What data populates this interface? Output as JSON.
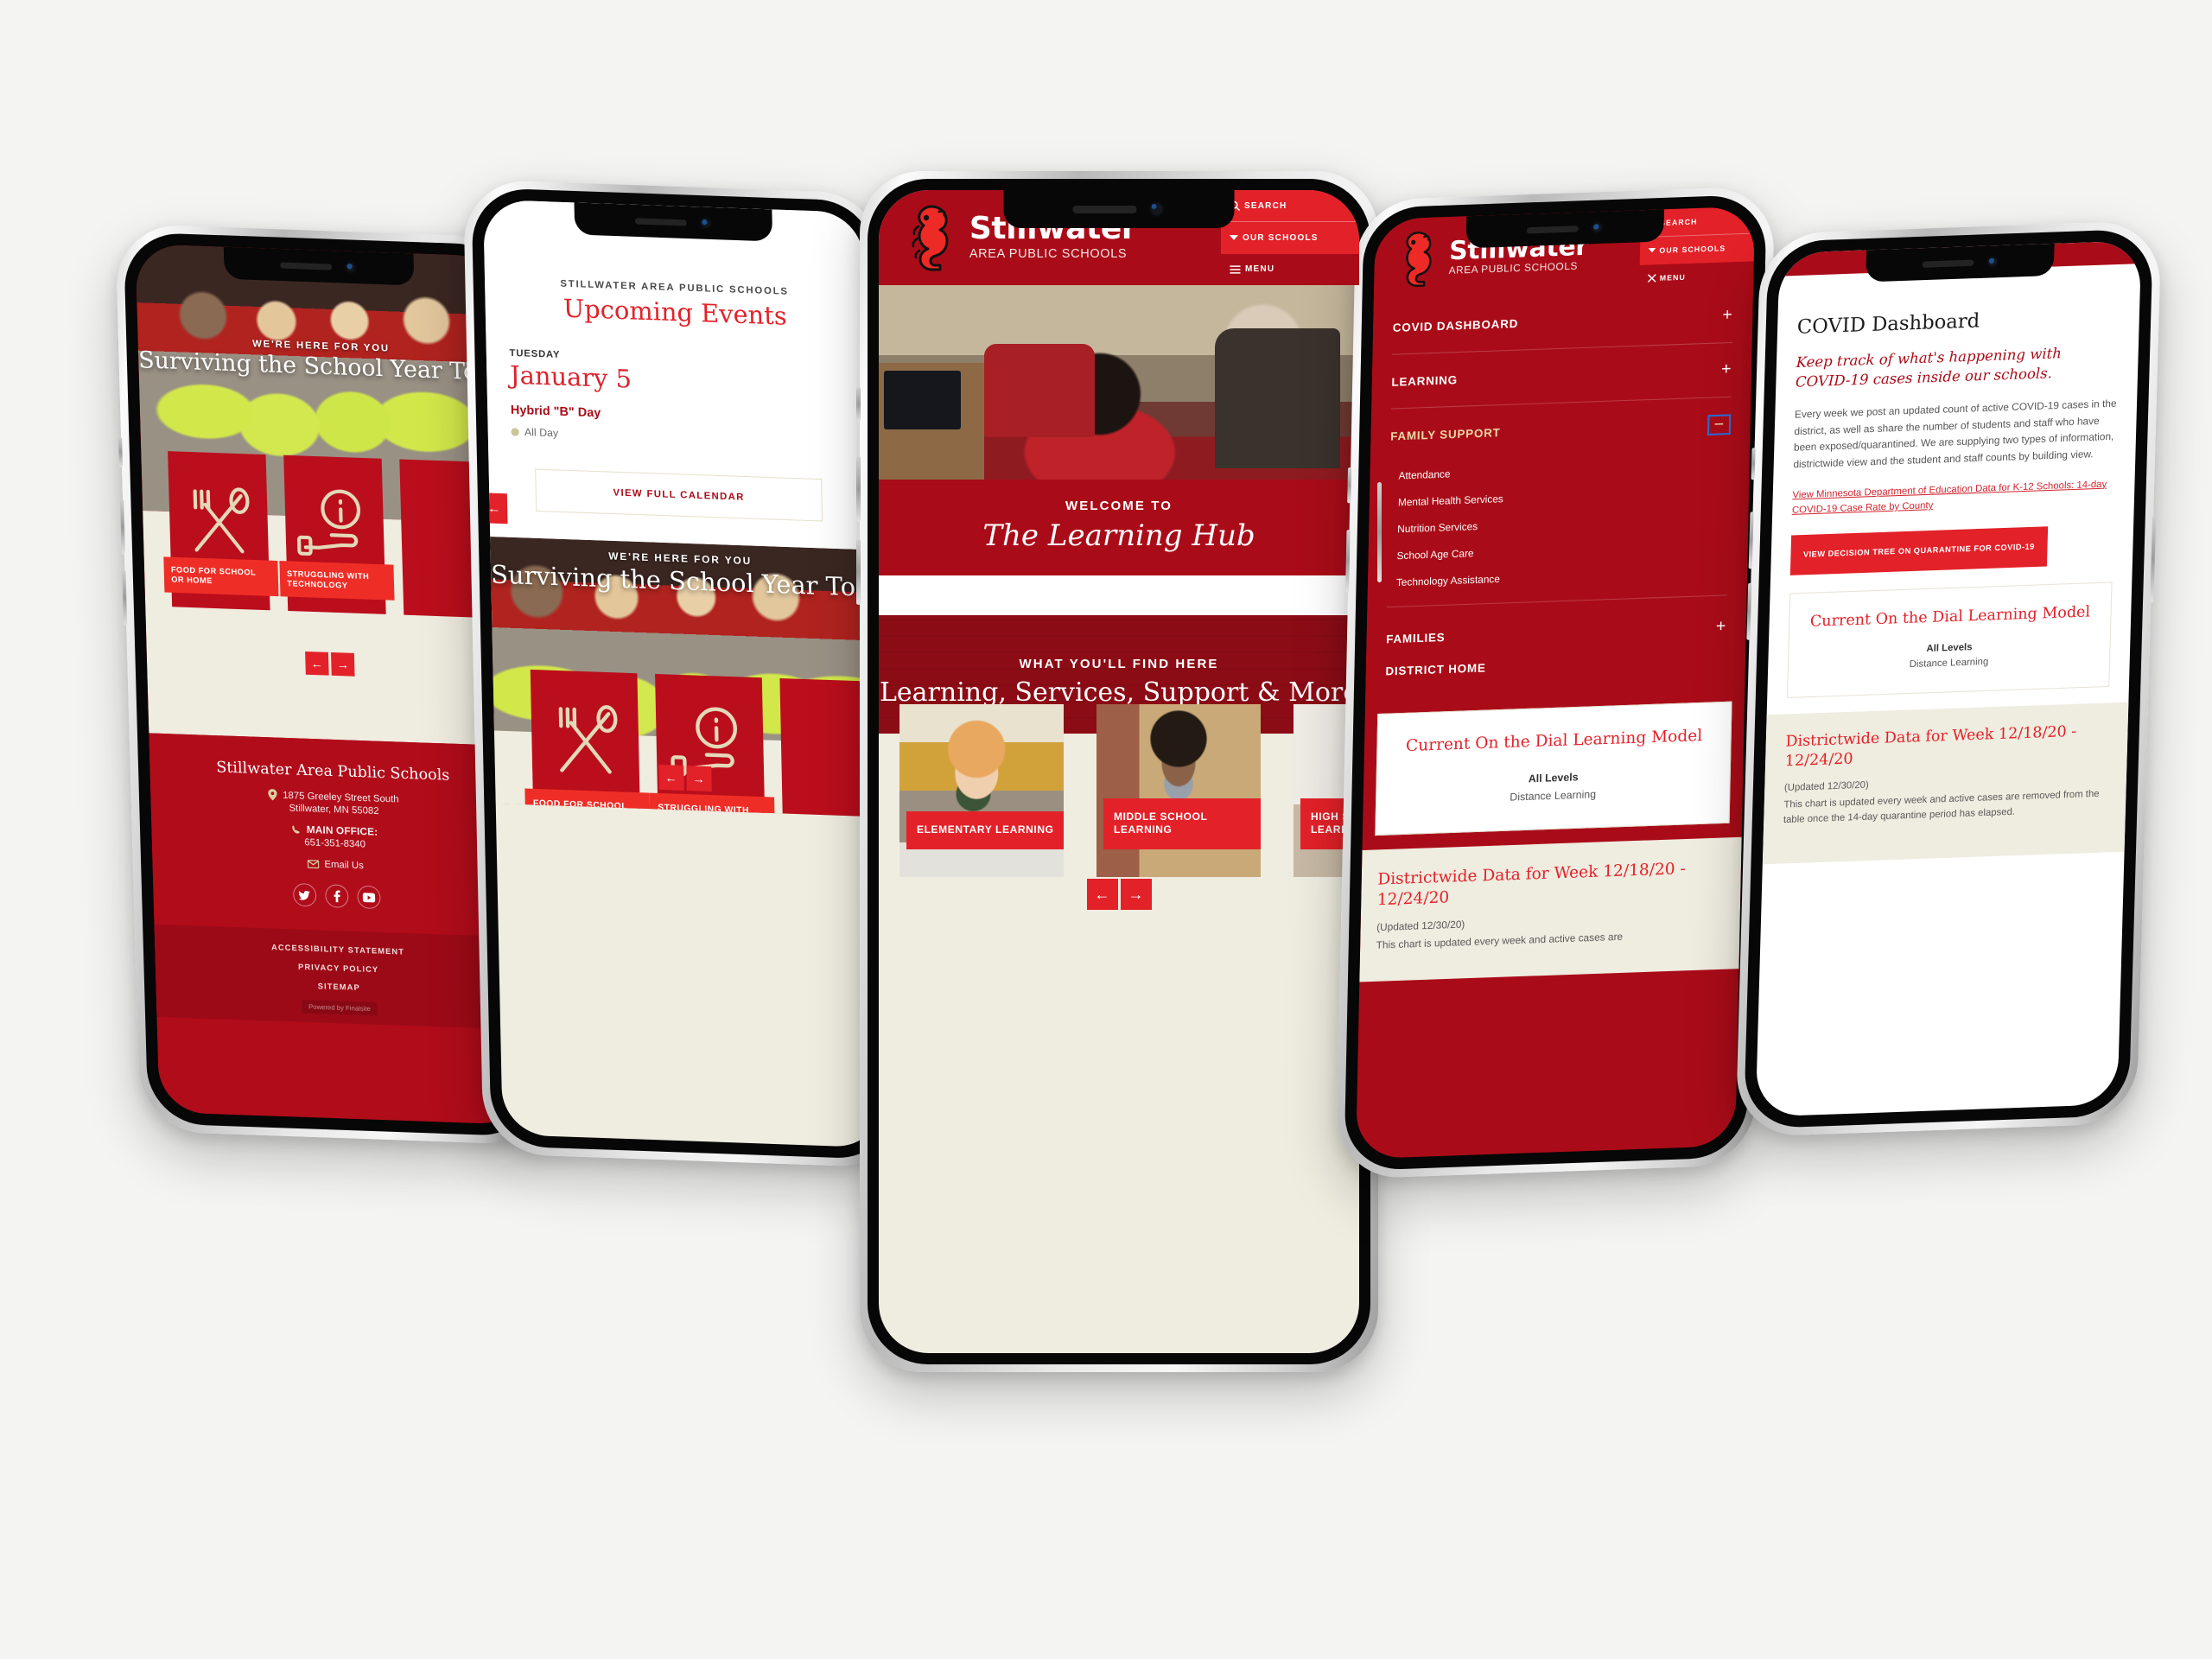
{
  "brand": {
    "name": "Stillwater",
    "tagline": "AREA PUBLIC SCHOOLS",
    "logo_icon": "seahorse-logo",
    "primary_red": "#a90c18",
    "accent_red": "#e32129",
    "cream": "#efece0"
  },
  "header": {
    "search_label": "SEARCH",
    "search_icon": "search-icon",
    "schools_label": "OUR SCHOOLS",
    "schools_icon": "chevron-down-icon",
    "menu_label": "MENU",
    "menu_icon": "hamburger-icon",
    "menu_open_label": "MENU",
    "menu_close_icon": "close-icon"
  },
  "phone1": {
    "hero": {
      "kicker": "WE'RE HERE FOR YOU",
      "title": "Surviving the School Year Together"
    },
    "tiles": [
      {
        "icon": "fork-knife-icon",
        "label": "FOOD FOR SCHOOL OR HOME"
      },
      {
        "icon": "hand-info-icon",
        "label": "STRUGGLING WITH TECHNOLOGY"
      },
      {
        "icon": "support-icon",
        "label": ""
      }
    ],
    "carousel": {
      "prev_icon": "arrow-left-icon",
      "next_icon": "arrow-right-icon"
    },
    "footer": {
      "org": "Stillwater Area Public Schools",
      "address_icon": "map-pin-icon",
      "address_line1": "1875 Greeley Street South",
      "address_line2": "Stillwater, MN  55082",
      "phone_icon": "phone-icon",
      "phone_label": "MAIN OFFICE:",
      "phone_number": "651-351-8340",
      "email_icon": "envelope-icon",
      "email_label": "Email Us",
      "social": [
        {
          "icon": "twitter-icon",
          "glyph": "ᵠ"
        },
        {
          "icon": "facebook-icon",
          "glyph": "f"
        },
        {
          "icon": "youtube-icon",
          "glyph": "▶"
        }
      ],
      "legal_links": [
        "ACCESSIBILITY STATEMENT",
        "PRIVACY POLICY",
        "SITEMAP"
      ],
      "powered_by": "Powered by Finalsite"
    }
  },
  "phone2": {
    "events": {
      "kicker": "STILLWATER AREA PUBLIC SCHOOLS",
      "heading": "Upcoming Events",
      "day_of_week": "TUESDAY",
      "date": "January 5",
      "event_title": "Hybrid \"B\" Day",
      "time": "All Day",
      "time_icon": "clock-icon",
      "cta": "VIEW FULL CALENDAR",
      "prev_icon": "arrow-left-icon"
    },
    "hero": {
      "kicker": "WE'RE HERE FOR YOU",
      "title": "Surviving the School Year Together"
    },
    "tiles": [
      {
        "icon": "fork-knife-icon",
        "label": "FOOD FOR SCHOOL OR HOME"
      },
      {
        "icon": "hand-info-icon",
        "label": "STRUGGLING WITH TECHNOLOGY"
      },
      {
        "icon": "support-icon",
        "label": ""
      }
    ],
    "carousel": {
      "prev_icon": "arrow-left-icon",
      "next_icon": "arrow-right-icon"
    }
  },
  "phone3": {
    "welcome": {
      "kicker": "WELCOME TO",
      "title": "The Learning Hub"
    },
    "find": {
      "kicker": "WHAT YOU'LL FIND HERE",
      "title": "Learning, Services, Support & More"
    },
    "cards": [
      {
        "label": "ELEMENTARY LEARNING",
        "image": "elementary-student-photo"
      },
      {
        "label": "MIDDLE SCHOOL LEARNING",
        "image": "middle-school-student-photo"
      },
      {
        "label": "HIGH SCHOOL LEARNING",
        "image": "high-school-student-photo"
      }
    ],
    "carousel": {
      "prev_icon": "arrow-left-icon",
      "next_icon": "arrow-right-icon"
    }
  },
  "phone4": {
    "menu": {
      "sections": [
        {
          "label": "COVID DASHBOARD",
          "state": "collapsed",
          "toggle": "+",
          "children": []
        },
        {
          "label": "LEARNING",
          "state": "collapsed",
          "toggle": "+",
          "children": []
        },
        {
          "label": "FAMILY SUPPORT",
          "state": "expanded",
          "toggle": "−",
          "children": [
            "Attendance",
            "Mental Health Services",
            "Nutrition Services",
            "School Age Care",
            "Technology Assistance"
          ]
        },
        {
          "label": "FAMILIES",
          "state": "collapsed",
          "toggle": "+",
          "children": []
        },
        {
          "label": "DISTRICT HOME",
          "state": "link",
          "toggle": "",
          "children": []
        }
      ]
    },
    "dial_card": {
      "title": "Current On the Dial Learning Model",
      "level_label": "All Levels",
      "level_value": "Distance Learning"
    },
    "data": {
      "title": "Districtwide Data for Week 12/18/20 - 12/24/20",
      "updated": "(Updated 12/30/20)",
      "note": "This chart is updated every week and active cases are"
    }
  },
  "phone5": {
    "page_title": "COVID Dashboard",
    "lede": "Keep track of what's happening with COVID-19 cases inside our schools.",
    "body": "Every week we post an updated count of active COVID-19 cases in the district, as well as share the number of students and staff who have been exposed/quarantined. We are supplying two types of information, districtwide view and the student and staff counts by building view.",
    "link": "View Minnesota Department of Education Data for K-12 Schools: 14-day COVID-19 Case Rate by County",
    "button": "VIEW DECISION TREE ON QUARANTINE FOR COVID-19",
    "dial_card": {
      "title": "Current On the Dial Learning Model",
      "level_label": "All Levels",
      "level_value": "Distance Learning"
    },
    "data": {
      "title": "Districtwide Data for Week 12/18/20 - 12/24/20",
      "updated": "(Updated 12/30/20)",
      "note": "This chart is updated every week and active cases are removed from the table once the 14-day quarantine period has elapsed."
    }
  }
}
